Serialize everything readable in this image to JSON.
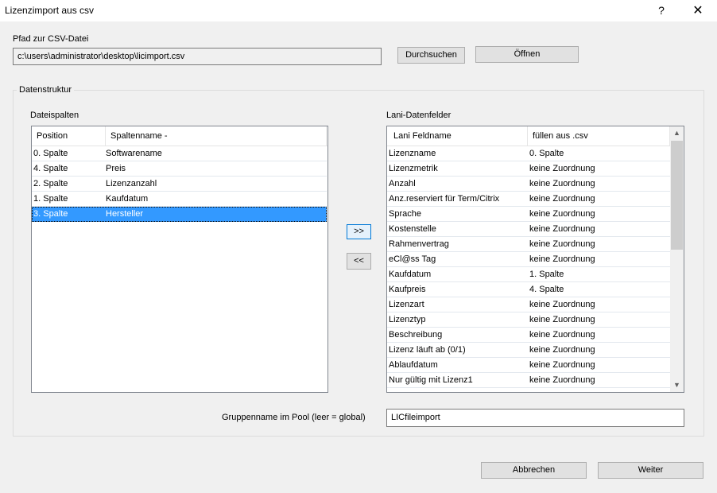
{
  "window": {
    "title": "Lizenzimport aus csv",
    "help_label": "?",
    "close_label": "✕"
  },
  "path": {
    "label": "Pfad zur CSV-Datei",
    "value": "c:\\users\\administrator\\desktop\\licimport.csv",
    "browse_label": "Durchsuchen",
    "open_label": "Öffnen"
  },
  "structure": {
    "legend": "Datenstruktur"
  },
  "file_columns": {
    "label": "Dateispalten",
    "headers": [
      "Position",
      "Spaltenname  -"
    ],
    "rows": [
      {
        "pos": "0. Spalte",
        "name": "Softwarename"
      },
      {
        "pos": "4. Spalte",
        "name": "Preis"
      },
      {
        "pos": "2. Spalte",
        "name": "Lizenzanzahl"
      },
      {
        "pos": "1. Spalte",
        "name": "Kaufdatum"
      },
      {
        "pos": "3. Spalte",
        "name": "Hersteller"
      }
    ],
    "selected_index": 4
  },
  "assign_buttons": {
    "add_label": ">>",
    "remove_label": "<<"
  },
  "lani_fields": {
    "label": "Lani-Datenfelder",
    "headers": [
      "Lani Feldname",
      "füllen aus .csv"
    ],
    "rows": [
      {
        "field": "Lizenzname",
        "source": "0. Spalte"
      },
      {
        "field": "Lizenzmetrik",
        "source": "keine Zuordnung"
      },
      {
        "field": "Anzahl",
        "source": "keine Zuordnung"
      },
      {
        "field": "Anz.reserviert für Term/Citrix",
        "source": "keine Zuordnung"
      },
      {
        "field": "Sprache",
        "source": "keine Zuordnung"
      },
      {
        "field": "Kostenstelle",
        "source": "keine Zuordnung"
      },
      {
        "field": "Rahmenvertrag",
        "source": "keine Zuordnung"
      },
      {
        "field": "eCl@ss Tag",
        "source": "keine Zuordnung"
      },
      {
        "field": "Kaufdatum",
        "source": "1. Spalte"
      },
      {
        "field": "Kaufpreis",
        "source": "4. Spalte"
      },
      {
        "field": "Lizenzart",
        "source": "keine Zuordnung"
      },
      {
        "field": "Lizenztyp",
        "source": "keine Zuordnung"
      },
      {
        "field": "Beschreibung",
        "source": "keine Zuordnung"
      },
      {
        "field": "Lizenz läuft ab (0/1)",
        "source": "keine Zuordnung"
      },
      {
        "field": "Ablaufdatum",
        "source": "keine Zuordnung"
      },
      {
        "field": "Nur gültig mit Lizenz1",
        "source": "keine Zuordnung"
      }
    ]
  },
  "group_name": {
    "label": "Gruppenname im Pool (leer = global)",
    "value": "LICfileimport"
  },
  "footer": {
    "cancel_label": "Abbrechen",
    "next_label": "Weiter"
  },
  "icons": {
    "scroll_up": "chevron-up-icon",
    "scroll_down": "chevron-down-icon"
  },
  "colors": {
    "selection": "#3399ff",
    "focus_border": "#0078d7"
  }
}
